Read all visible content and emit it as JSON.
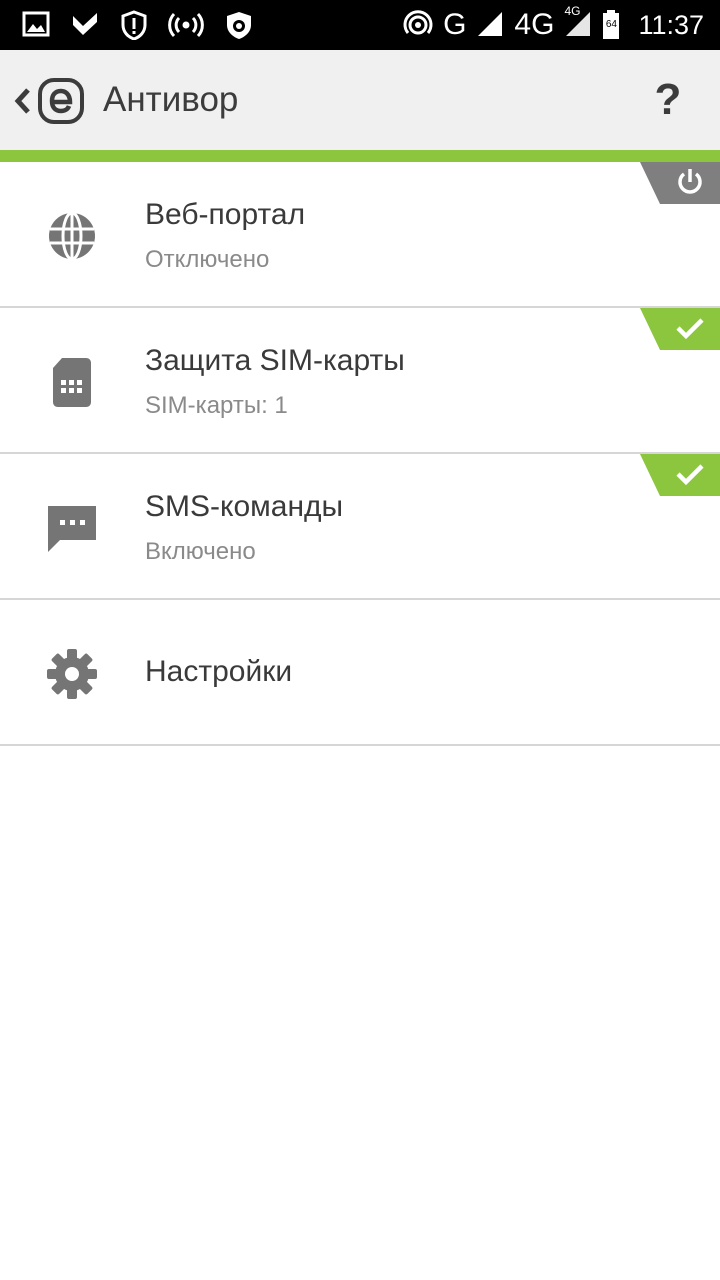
{
  "status_bar": {
    "network_label": "G",
    "lte_label": "4G",
    "lte_small": "4G",
    "battery_level": "64",
    "time": "11:37",
    "left_icons": [
      "image-icon",
      "check-flag-icon",
      "shield-alert-icon",
      "hotspot-icon",
      "bug-icon"
    ]
  },
  "appbar": {
    "title": "Антивор",
    "help_label": "?"
  },
  "colors": {
    "accent": "#8cc63f",
    "appbar_bg": "#f0f0f0",
    "badge_off": "#7f7f7f"
  },
  "items": [
    {
      "title": "Веб-портал",
      "subtitle": "Отключено",
      "icon": "globe-icon",
      "badge": "power-off"
    },
    {
      "title": "Защита SIM-карты",
      "subtitle": "SIM-карты: 1",
      "icon": "sim-card-icon",
      "badge": "check"
    },
    {
      "title": "SMS-команды",
      "subtitle": "Включено",
      "icon": "sms-icon",
      "badge": "check"
    },
    {
      "title": "Настройки",
      "icon": "gear-icon"
    }
  ]
}
